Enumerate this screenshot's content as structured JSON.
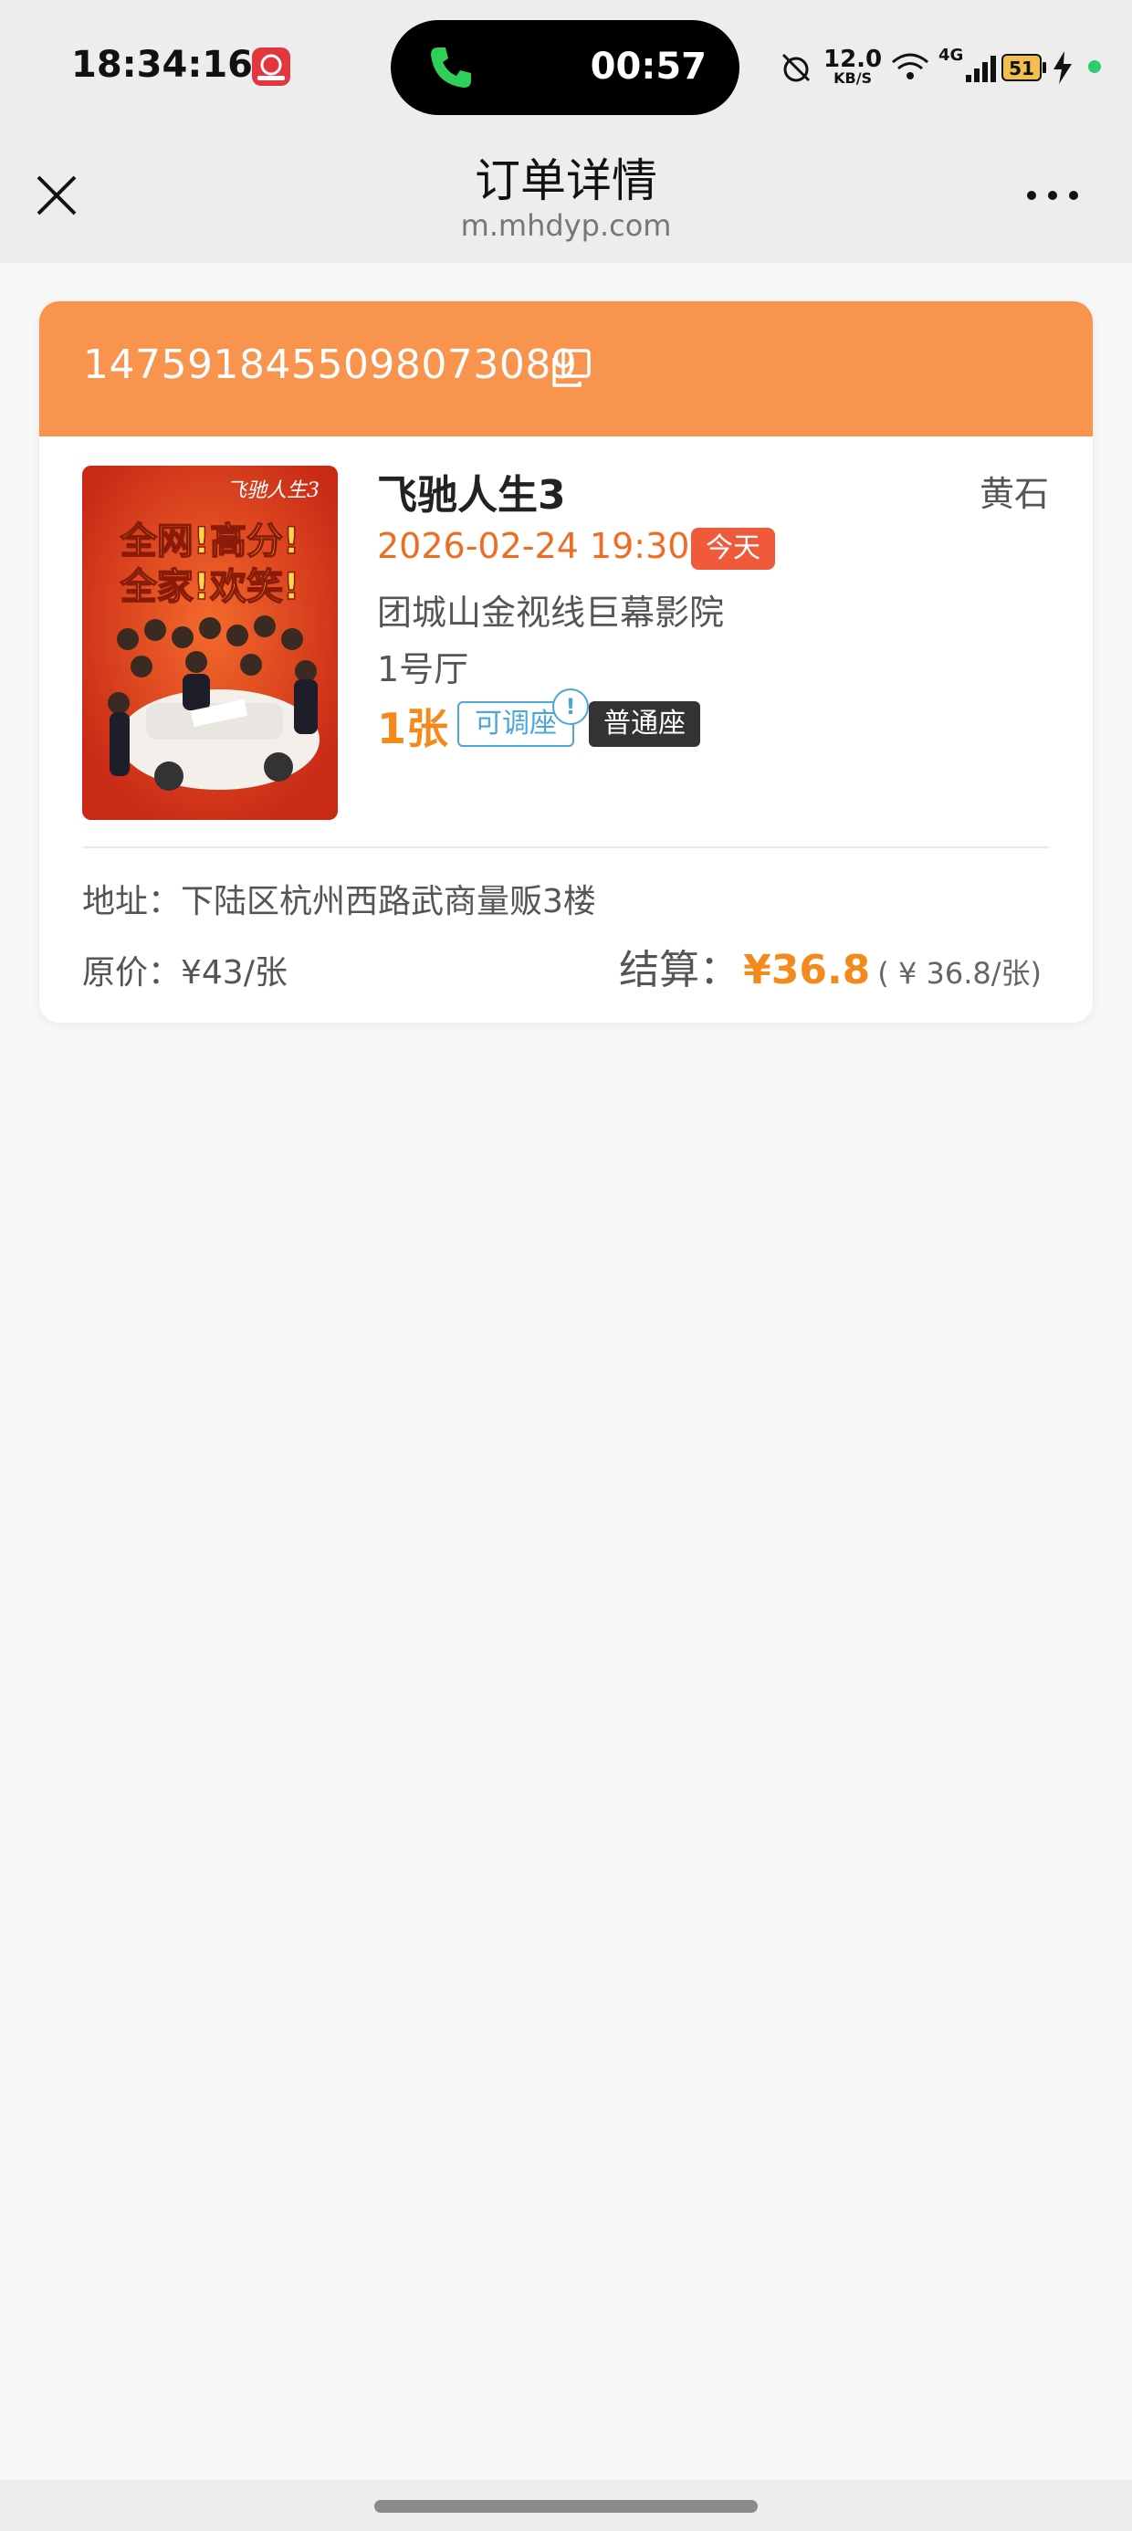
{
  "status_bar": {
    "time": "18:34:16",
    "call_timer": "00:57",
    "net_speed_value": "12.0",
    "net_speed_unit": "KB/S",
    "signal_label": "4G"
  },
  "nav": {
    "title": "订单详情",
    "subtitle": "m.mhdyp.com"
  },
  "order": {
    "number": "1475918455098073089",
    "movie_title": "飞驰人生3",
    "city": "黄石",
    "show_time": "2026-02-24 19:30",
    "today_badge": "今天",
    "cinema": "团城山金视线巨幕影院",
    "hall": "1号厅",
    "ticket_count": "1张",
    "adjust_tag": "可调座",
    "info_mark": "!",
    "seat_type": "普通座",
    "address": "地址：下陆区杭州西路武商量贩3楼",
    "original_price": "原价：¥43/张",
    "settle_label": "结算：",
    "settle_amount": "¥36.8",
    "settle_per": "( ¥ 36.8/张)"
  },
  "poster": {
    "logo_text": "飞驰人生3",
    "headline_1": "全网!高分!",
    "headline_2": "全家!欢笑!"
  },
  "colors": {
    "header_orange": "#f9944e",
    "accent_orange": "#f58a1c",
    "time_orange": "#ee6d23",
    "badge_red": "#f0593a",
    "tag_blue": "#4aa7d8"
  }
}
